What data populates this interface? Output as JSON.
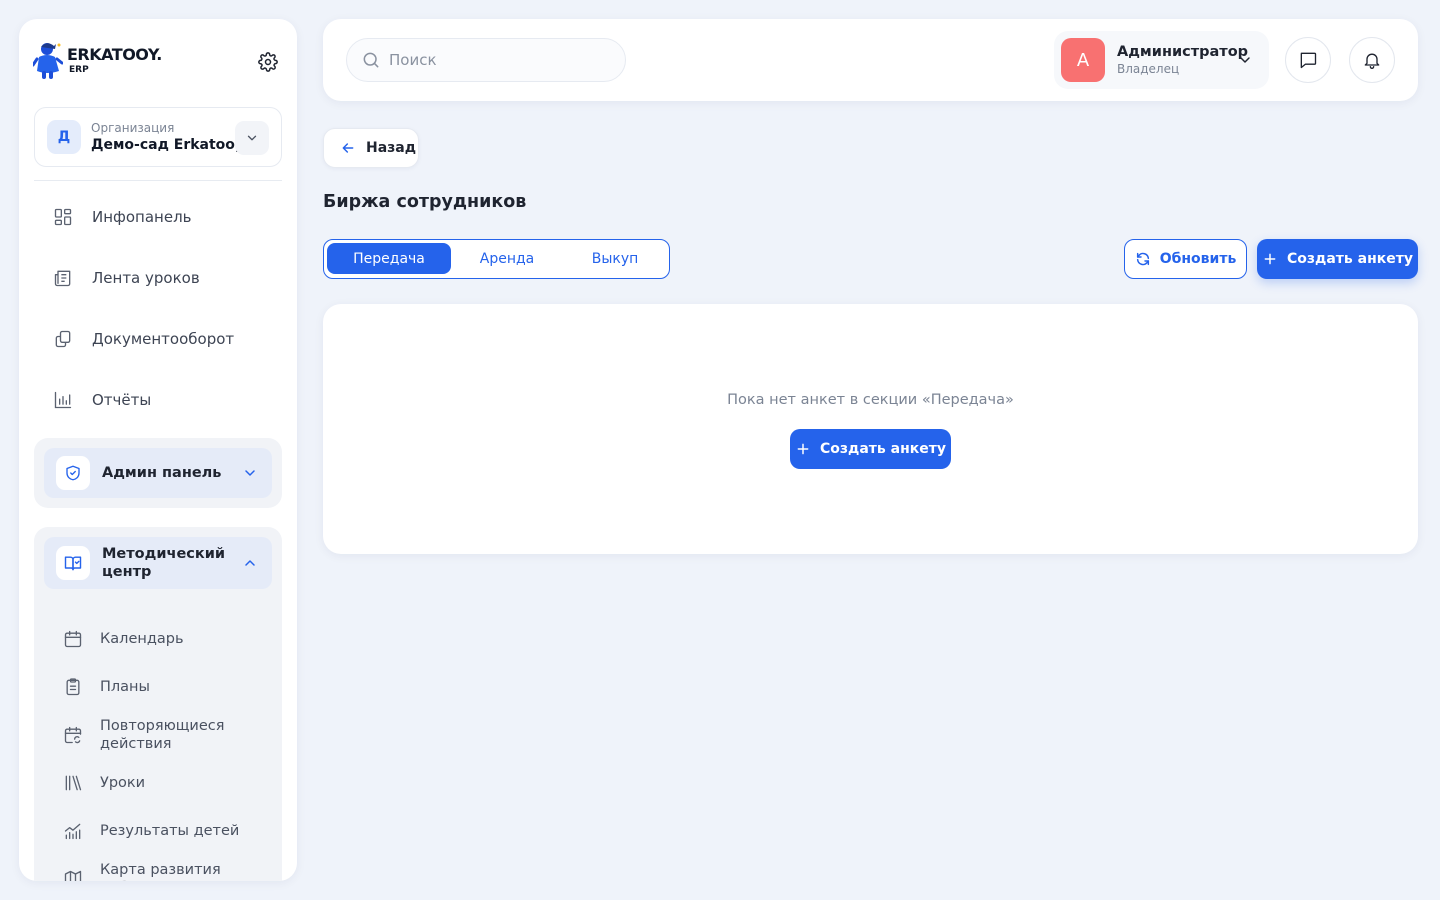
{
  "brand": {
    "name": "ERKATOOY.",
    "sub": "ERP"
  },
  "org": {
    "label": "Организация",
    "name": "Демо-сад Erkatooy",
    "badge": "Д"
  },
  "nav": {
    "items": [
      {
        "label": "Инфопанель",
        "icon": "grid-icon"
      },
      {
        "label": "Лента уроков",
        "icon": "newspaper-icon"
      },
      {
        "label": "Документооборот",
        "icon": "documents-icon"
      },
      {
        "label": "Отчёты",
        "icon": "bar-chart-icon"
      }
    ],
    "admin_group": {
      "label": "Админ панель",
      "icon": "shield-check-icon"
    },
    "method_group": {
      "label": "Методический центр",
      "icon": "book-open-icon",
      "items": [
        {
          "label": "Календарь",
          "icon": "calendar-icon"
        },
        {
          "label": "Планы",
          "icon": "clipboard-icon"
        },
        {
          "label": "Повторяющиеся действия",
          "icon": "calendar-repeat-icon"
        },
        {
          "label": "Уроки",
          "icon": "library-icon"
        },
        {
          "label": "Результаты детей",
          "icon": "chart-line-icon"
        },
        {
          "label": "Карта развития ребенка",
          "icon": "map-icon"
        }
      ]
    }
  },
  "search": {
    "placeholder": "Поиск"
  },
  "user": {
    "initial": "A",
    "name": "Администратор",
    "role": "Владелец"
  },
  "main": {
    "back_label": "Назад",
    "title": "Биржа сотрудников",
    "tabs": [
      {
        "label": "Передача",
        "active": true
      },
      {
        "label": "Аренда",
        "active": false
      },
      {
        "label": "Выкуп",
        "active": false
      }
    ],
    "refresh_label": "Обновить",
    "create_label": "Создать анкету",
    "empty_text": "Пока нет анкет в секции «Передача»",
    "empty_create_label": "Создать анкету"
  },
  "colors": {
    "accent": "#2563eb",
    "avatar": "#f87171",
    "background": "#eff3fa"
  }
}
